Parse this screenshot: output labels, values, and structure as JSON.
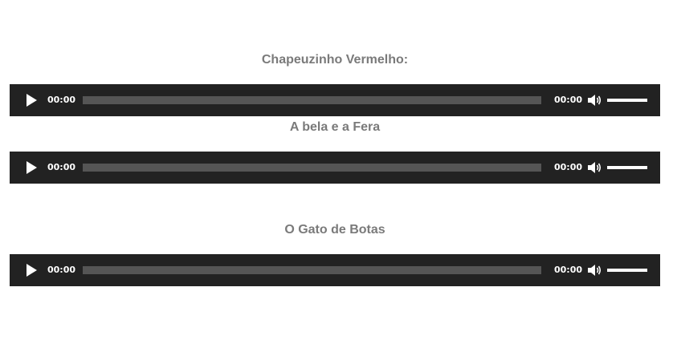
{
  "tracks": [
    {
      "title": "Chapeuzinho Vermelho:",
      "current_time": "00:00",
      "duration": "00:00",
      "progress": 0,
      "volume": 1.0
    },
    {
      "title": "A bela e a Fera",
      "current_time": "00:00",
      "duration": "00:00",
      "progress": 0,
      "volume": 1.0
    },
    {
      "title": "O Gato de Botas",
      "current_time": "00:00",
      "duration": "00:00",
      "progress": 0,
      "volume": 1.0
    }
  ],
  "icons": {
    "play": "play-icon",
    "volume": "speaker-icon"
  },
  "colors": {
    "player_bg": "#222222",
    "title_text": "#7a7a7a",
    "progress_track": "#555555",
    "volume_fill": "#ffffff"
  }
}
